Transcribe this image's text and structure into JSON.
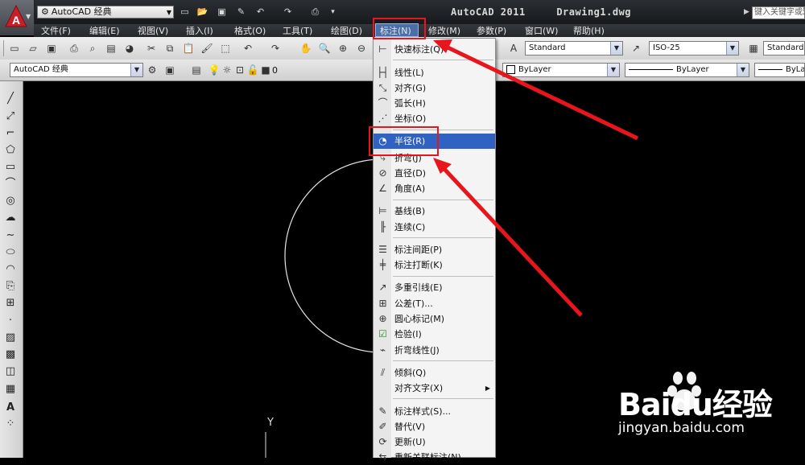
{
  "title_bar": {
    "workspace": "AutoCAD 经典",
    "app_title": "AutoCAD 2011     Drawing1.dwg",
    "search_placeholder": "键入关键字或短语"
  },
  "menu": [
    "文件(F)",
    "编辑(E)",
    "视图(V)",
    "插入(I)",
    "格式(O)",
    "工具(T)",
    "绘图(D)",
    "标注(N)",
    "修改(M)",
    "参数(P)",
    "窗口(W)",
    "帮助(H)"
  ],
  "active_menu": "标注(N)",
  "toolbar": {
    "text_style": "Standard",
    "dim_style": "ISO-25",
    "table_style": "Standard",
    "workspace_combo": "AutoCAD 经典",
    "layer": "0",
    "color": "ByLayer",
    "linetype": "ByLayer",
    "lineweight": "ByLa"
  },
  "dimension_menu": [
    {
      "label": "快速标注(Q)",
      "icon": "quick-dim-icon"
    },
    {
      "separator": true
    },
    {
      "label": "线性(L)",
      "icon": "linear-icon"
    },
    {
      "label": "对齐(G)",
      "icon": "aligned-icon"
    },
    {
      "label": "弧长(H)",
      "icon": "arc-length-icon"
    },
    {
      "label": "坐标(O)",
      "icon": "ordinate-icon"
    },
    {
      "separator": true
    },
    {
      "label": "半径(R)",
      "icon": "radius-icon",
      "highlighted": true
    },
    {
      "label": "折弯(J)",
      "icon": "jogged-icon"
    },
    {
      "label": "直径(D)",
      "icon": "diameter-icon"
    },
    {
      "label": "角度(A)",
      "icon": "angular-icon"
    },
    {
      "separator": true
    },
    {
      "label": "基线(B)",
      "icon": "baseline-icon"
    },
    {
      "label": "连续(C)",
      "icon": "continue-icon"
    },
    {
      "separator": true
    },
    {
      "label": "标注间距(P)",
      "icon": "dim-space-icon"
    },
    {
      "label": "标注打断(K)",
      "icon": "dim-break-icon"
    },
    {
      "separator": true
    },
    {
      "label": "多重引线(E)",
      "icon": "multileader-icon"
    },
    {
      "label": "公差(T)...",
      "icon": "tolerance-icon"
    },
    {
      "label": "圆心标记(M)",
      "icon": "center-mark-icon"
    },
    {
      "label": "检验(I)",
      "icon": "inspection-icon"
    },
    {
      "label": "折弯线性(J)",
      "icon": "jogged-linear-icon"
    },
    {
      "separator": true
    },
    {
      "label": "倾斜(Q)",
      "icon": "oblique-icon"
    },
    {
      "label": "对齐文字(X)",
      "icon": "",
      "submenu": true
    },
    {
      "separator": true
    },
    {
      "label": "标注样式(S)...",
      "icon": "dim-style-icon"
    },
    {
      "label": "替代(V)",
      "icon": "override-icon"
    },
    {
      "label": "更新(U)",
      "icon": "update-icon"
    },
    {
      "label": "重新关联标注(N)",
      "icon": "reassociate-icon"
    }
  ],
  "canvas": {
    "ucs_label": "Y"
  },
  "watermark": {
    "brand": "Baidu经验",
    "url": "jingyan.baidu.com"
  },
  "accent_colors": {
    "highlight": "#3062c3",
    "annotation": "#e8161c"
  }
}
